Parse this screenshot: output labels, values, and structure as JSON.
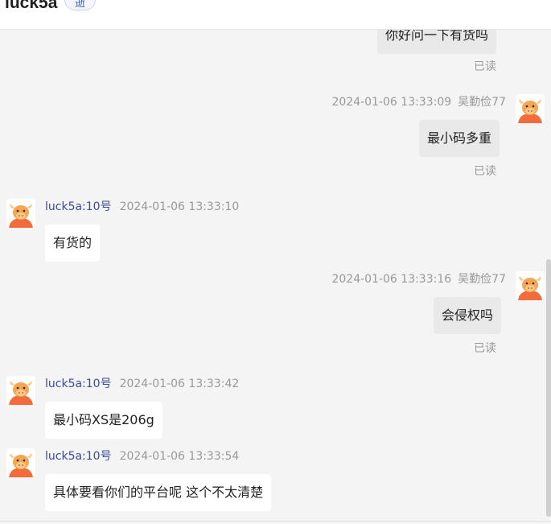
{
  "header": {
    "title": "luck5a",
    "badge": "逝"
  },
  "messages": [
    {
      "side": "right",
      "text": "你好问一下有货吗",
      "read": "已读"
    },
    {
      "side": "right",
      "time": "2024-01-06 13:33:09",
      "name": "吴勤俭77",
      "text": "最小码多重",
      "read": "已读"
    },
    {
      "side": "left",
      "name": "luck5a:10号",
      "time": "2024-01-06 13:33:10",
      "text": "有货的"
    },
    {
      "side": "right",
      "time": "2024-01-06 13:33:16",
      "name": "吴勤俭77",
      "text": "会侵权吗",
      "read": "已读"
    },
    {
      "side": "left",
      "name": "luck5a:10号",
      "time": "2024-01-06 13:33:42",
      "text": "最小码XS是206g"
    },
    {
      "side": "left",
      "name": "luck5a:10号",
      "time": "2024-01-06 13:33:54",
      "text": "具体要看你们的平台呢 这个不太清楚"
    }
  ],
  "icons": {
    "avatar": "cartoon-bull-avatar"
  },
  "colors": {
    "my_bubble": "#e9e9e9",
    "their_bubble": "#ffffff",
    "sender_name": "#3a4c9c",
    "meta": "#999999"
  }
}
